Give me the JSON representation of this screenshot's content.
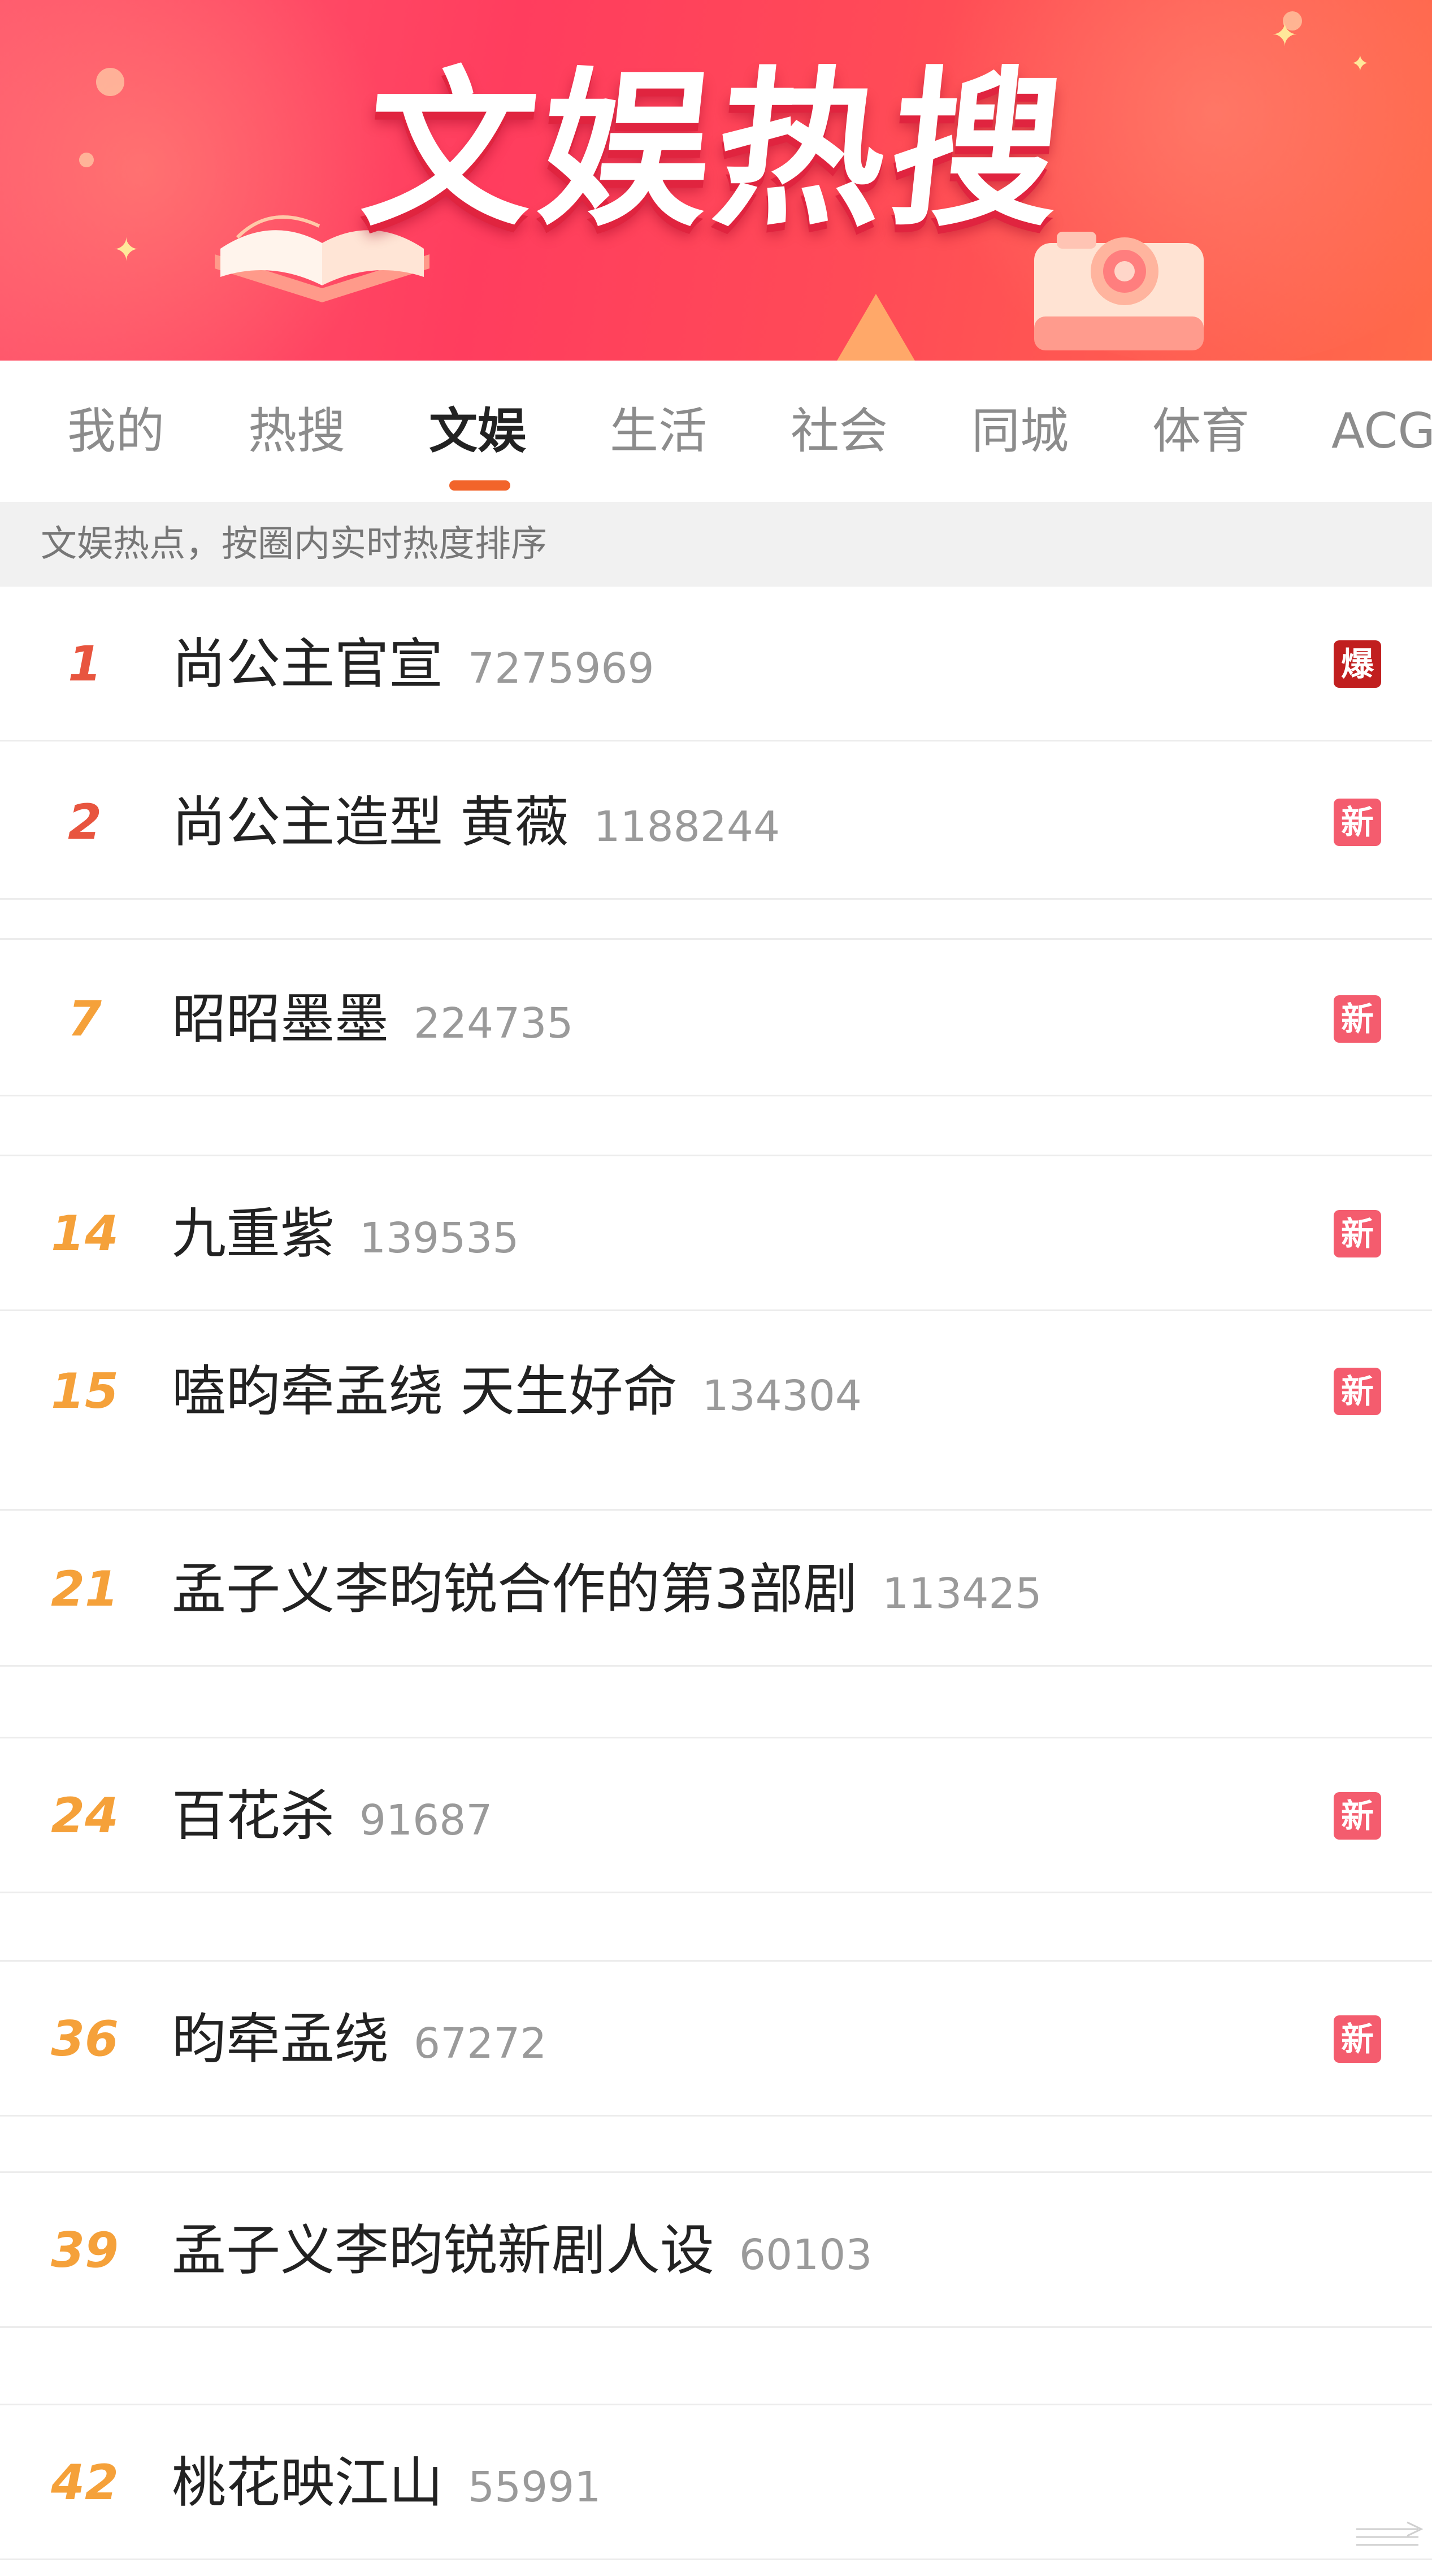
{
  "banner": {
    "title": "文娱热搜"
  },
  "tabs": [
    {
      "label": "我的",
      "active": false
    },
    {
      "label": "热搜",
      "active": false
    },
    {
      "label": "文娱",
      "active": true
    },
    {
      "label": "生活",
      "active": false
    },
    {
      "label": "社会",
      "active": false
    },
    {
      "label": "同城",
      "active": false
    },
    {
      "label": "体育",
      "active": false
    },
    {
      "label": "ACG",
      "active": false
    }
  ],
  "subtitle": "文娱热点，按圈内实时热度排序",
  "colors": {
    "rank_top": "#e8553f",
    "rank_other": "#f5a13a",
    "badge_hot": "#c11f1f",
    "badge_new": "#f45c6e",
    "tab_indicator": "#f2642a"
  },
  "items": [
    {
      "rank": "1",
      "title": "尚公主官宣",
      "count": "7275969",
      "badge": "爆",
      "badge_type": "hot"
    },
    {
      "rank": "2",
      "title": "尚公主造型 黄薇",
      "count": "1188244",
      "badge": "新",
      "badge_type": "new"
    },
    {
      "rank": "7",
      "title": "昭昭墨墨",
      "count": "224735",
      "badge": "新",
      "badge_type": "new"
    },
    {
      "rank": "14",
      "title": "九重紫",
      "count": "139535",
      "badge": "新",
      "badge_type": "new"
    },
    {
      "rank": "15",
      "title": "嗑昀牵孟绕 天生好命",
      "count": "134304",
      "badge": "新",
      "badge_type": "new"
    },
    {
      "rank": "21",
      "title": "孟子义李昀锐合作的第3部剧",
      "count": "113425",
      "badge": "",
      "badge_type": "none"
    },
    {
      "rank": "24",
      "title": "百花杀",
      "count": "91687",
      "badge": "新",
      "badge_type": "new"
    },
    {
      "rank": "36",
      "title": "昀牵孟绕",
      "count": "67272",
      "badge": "新",
      "badge_type": "new"
    },
    {
      "rank": "39",
      "title": "孟子义李昀锐新剧人设",
      "count": "60103",
      "badge": "",
      "badge_type": "none"
    },
    {
      "rank": "42",
      "title": "桃花映江山",
      "count": "55991",
      "badge": "",
      "badge_type": "none"
    }
  ]
}
